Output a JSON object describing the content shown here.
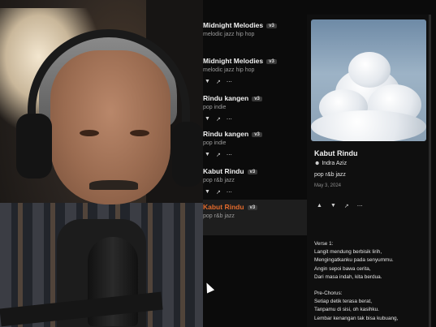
{
  "songs": [
    {
      "title": "Midnight Melodies",
      "version": "v3",
      "genre": "melodic jazz hip hop"
    },
    {
      "title": "Midnight Melodies",
      "version": "v3",
      "genre": "melodic jazz hip hop"
    },
    {
      "title": "Rindu kangen",
      "version": "v3",
      "genre": "pop indie"
    },
    {
      "title": "Rindu kangen",
      "version": "v3",
      "genre": "pop indie"
    },
    {
      "title": "Kabut Rindu",
      "version": "v3",
      "genre": "pop r&b jazz"
    },
    {
      "title": "Kabut Rindu",
      "version": "v3",
      "genre": "pop r&b jazz"
    }
  ],
  "detail": {
    "title": "Kabut Rindu",
    "artist": "Indra Aziz",
    "tags": "pop r&b jazz",
    "date": "May 3, 2024"
  },
  "lyrics": [
    "Verse 1:",
    "Langit mendung berbisik lirih,",
    "Mengingatkanku pada senyummu.",
    "Angin sepoi bawa cerita,",
    "Dari masa indah, kita berdua.",
    "",
    "Pre-Chorus:",
    "Setiap detik terasa berat,",
    "Tanpamu di sisi, oh kasihku.",
    "Lembar kenangan tak bisa kubuang,"
  ],
  "icons": {
    "dislike": "thumbs-down-icon",
    "like": "thumbs-up-icon",
    "share": "share-icon",
    "more": "more-icon",
    "artist": "person-icon"
  },
  "colors": {
    "active_title": "#e26a2c"
  }
}
